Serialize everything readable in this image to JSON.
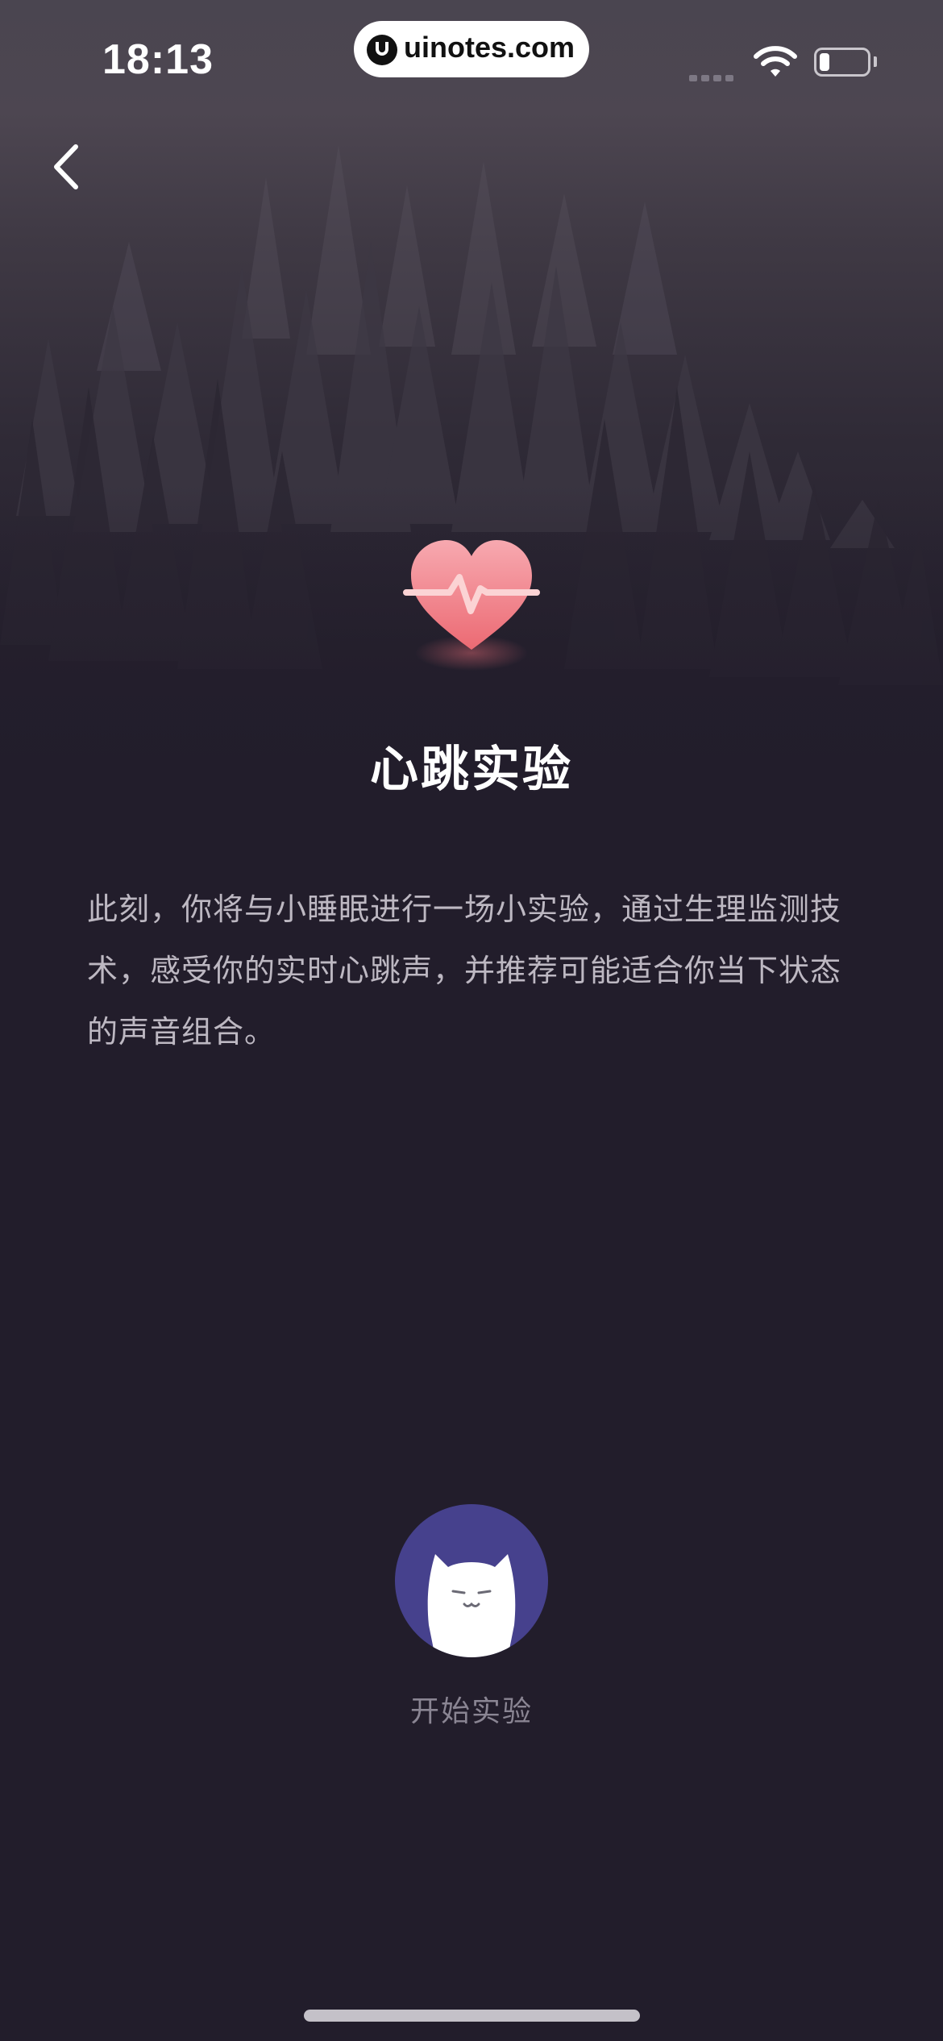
{
  "status_bar": {
    "time": "18:13",
    "url": "uinotes.com",
    "wifi_icon": "wifi-icon",
    "battery_icon": "battery-low-icon"
  },
  "nav": {
    "back_icon": "chevron-left-icon"
  },
  "hero": {
    "icon": "heartbeat-heart-icon",
    "title": "心跳实验"
  },
  "description": "此刻，你将与小睡眠进行一场小实验，通过生理监测技术，感受你的实时心跳声，并推荐可能适合你当下状态的声音组合。",
  "start": {
    "avatar_icon": "sleeping-cat-moon-icon",
    "label": "开始实验"
  },
  "colors": {
    "background": "#221d2b",
    "avatar_bg": "#46418d",
    "heart_top": "#f7a3ad",
    "heart_bottom": "#ec6c74",
    "moon": "#f3c97a"
  }
}
